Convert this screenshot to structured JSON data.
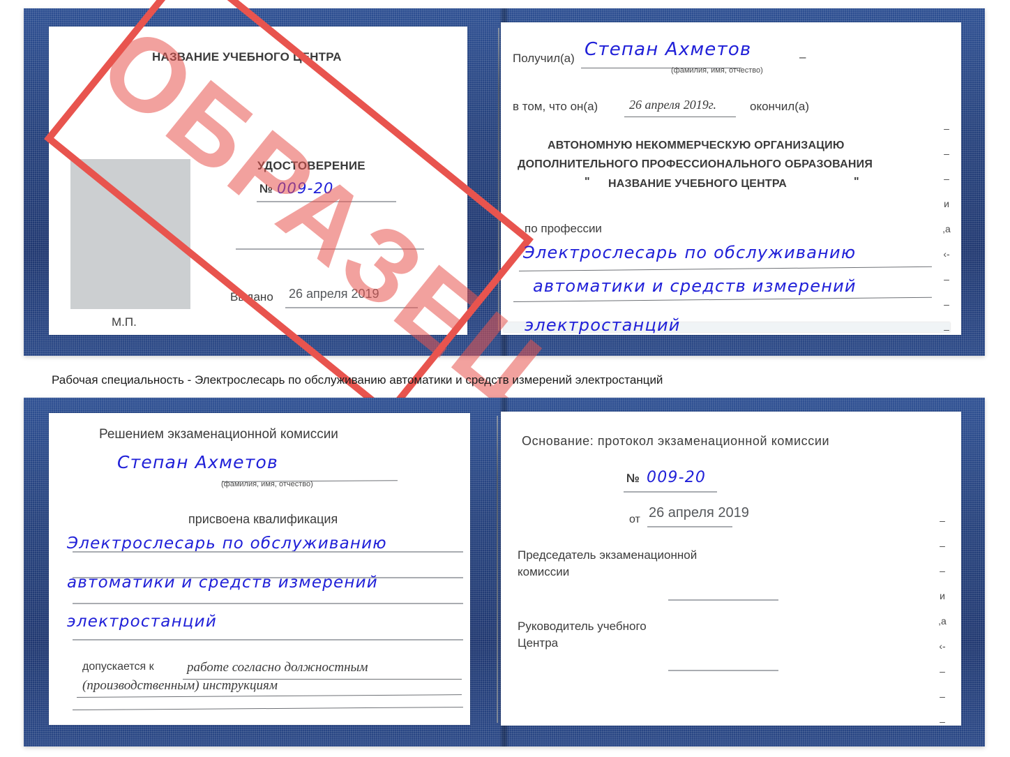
{
  "document": {
    "type": "certificate-scan",
    "caption": "Рабочая специальность - Электрослесарь по обслуживанию автоматики и средств измерений электростанций"
  },
  "colors": {
    "cover_blue": "#25417c",
    "stamp_red": "#e8544e",
    "handwriting_blue": "#2020d8",
    "photo_placeholder_gray": "#cccfd1",
    "rule_gray": "#a9acb1"
  },
  "stamp": {
    "label": "ОБРАЗЕЦ"
  },
  "certificate_1": {
    "left_page": {
      "org_title": "НАЗВАНИЕ УЧЕБНОГО ЦЕНТРА",
      "doc_title": "УДОСТОВЕРЕНИЕ",
      "number_label": "№",
      "number_value": "009-20",
      "issued_label": "Выдано",
      "issued_value": "26 апреля 2019",
      "seal_label": "М.П.",
      "photo_placeholder": ""
    },
    "right_page": {
      "received_label": "Получил(а)",
      "received_value": "Степан Ахметов",
      "fio_hint": "(фамилия, имя, отчество)",
      "that_he_label": "в том, что он(а)",
      "completion_date": "26 апреля 2019г.",
      "finished_label": "окончил(а)",
      "org_line1": "АВТОНОМНУЮ НЕКОММЕРЧЕСКУЮ ОРГАНИЗАЦИЮ",
      "org_line2": "ДОПОЛНИТЕЛЬНОГО ПРОФЕССИОНАЛЬНОГО ОБРАЗОВАНИЯ",
      "org_quote_open": "\"",
      "org_line3": "НАЗВАНИЕ УЧЕБНОГО ЦЕНТРА",
      "org_quote_close": "\"",
      "profession_label": "по профессии",
      "profession_line1": "Электрослесарь по обслуживанию",
      "profession_line2": "автоматики и средств измерений",
      "profession_line3": "электростанций",
      "margin_glyphs": "–\n–\n–\nи\n,а\n‹-\n–\n–\n–\n–"
    }
  },
  "certificate_2": {
    "left_page": {
      "commission_label": "Решением экзаменационной комиссии",
      "name_value": "Степан Ахметов",
      "fio_hint": "(фамилия, имя, отчество)",
      "qualification_label": "присвоена квалификация",
      "qualification_line1": "Электрослесарь по обслуживанию",
      "qualification_line2": "автоматики и средств измерений",
      "qualification_line3": "электростанций",
      "admitted_label": "допускается к",
      "admitted_value_line1": "работе согласно должностным",
      "admitted_value_line2": "(производственным) инструкциям"
    },
    "right_page": {
      "basis_label": "Основание: протокол экзаменационной комиссии",
      "protocol_number_label": "№",
      "protocol_number_value": "009-20",
      "protocol_date_label": "от",
      "protocol_date_value": "26 апреля 2019",
      "chairman_line1": "Председатель экзаменационной",
      "chairman_line2": "комиссии",
      "head_line1": "Руководитель учебного",
      "head_line2": "Центра",
      "margin_glyphs": "–\n–\n–\nи\n,а\n‹-\n–\n–\n–\n–"
    }
  }
}
